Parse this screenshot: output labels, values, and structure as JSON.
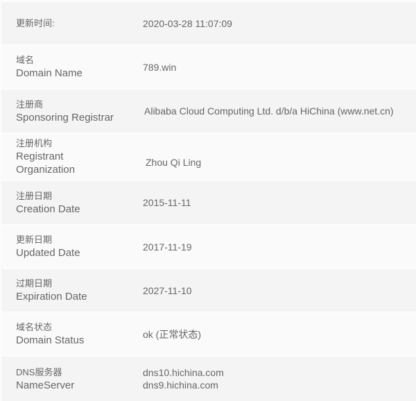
{
  "rows": [
    {
      "zh": "更新时间:",
      "en": "",
      "value": "2020-03-28 11:07:09"
    },
    {
      "zh": "域名",
      "en": "Domain Name",
      "value": "789.win"
    },
    {
      "zh": "注册商",
      "en": "Sponsoring Registrar",
      "value": "Alibaba Cloud Computing Ltd. d/b/a HiChina (www.net.cn)"
    },
    {
      "zh": "注册机构",
      "en_lines": [
        "Registrant",
        "Organization"
      ],
      "value": "Zhou Qi Ling"
    },
    {
      "zh": "注册日期",
      "en": "Creation Date",
      "value": "2015-11-11"
    },
    {
      "zh": "更新日期",
      "en": "Updated Date",
      "value": "2017-11-19"
    },
    {
      "zh": "过期日期",
      "en": "Expiration Date",
      "value": "2027-11-10"
    },
    {
      "zh": "域名状态",
      "en": "Domain Status",
      "value": "ok (正常状态)"
    },
    {
      "zh": "DNS服务器",
      "en": "NameServer",
      "values": [
        "dns10.hichina.com",
        "dns9.hichina.com"
      ]
    }
  ]
}
